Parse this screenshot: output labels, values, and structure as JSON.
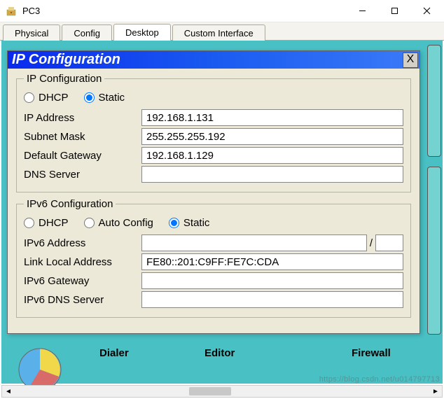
{
  "window": {
    "title": "PC3"
  },
  "tabs": [
    {
      "label": "Physical",
      "active": false
    },
    {
      "label": "Config",
      "active": false
    },
    {
      "label": "Desktop",
      "active": true
    },
    {
      "label": "Custom Interface",
      "active": false
    }
  ],
  "dialog": {
    "title": "IP Configuration",
    "close": "X"
  },
  "ipv4": {
    "legend": "IP Configuration",
    "mode_dhcp": "DHCP",
    "mode_static": "Static",
    "selected": "static",
    "ip_label": "IP Address",
    "ip_value": "192.168.1.131",
    "mask_label": "Subnet Mask",
    "mask_value": "255.255.255.192",
    "gw_label": "Default Gateway",
    "gw_value": "192.168.1.129",
    "dns_label": "DNS Server",
    "dns_value": ""
  },
  "ipv6": {
    "legend": "IPv6 Configuration",
    "mode_dhcp": "DHCP",
    "mode_auto": "Auto Config",
    "mode_static": "Static",
    "selected": "static",
    "addr_label": "IPv6 Address",
    "addr_value": "",
    "prefix_value": "",
    "ll_label": "Link Local Address",
    "ll_value": "FE80::201:C9FF:FE7C:CDA",
    "gw_label": "IPv6 Gateway",
    "gw_value": "",
    "dns_label": "IPv6 DNS Server",
    "dns_value": ""
  },
  "desktop_icons": {
    "dialer": "Dialer",
    "editor": "Editor",
    "firewall": "Firewall"
  },
  "watermark": "https://blog.csdn.net/u014797713"
}
